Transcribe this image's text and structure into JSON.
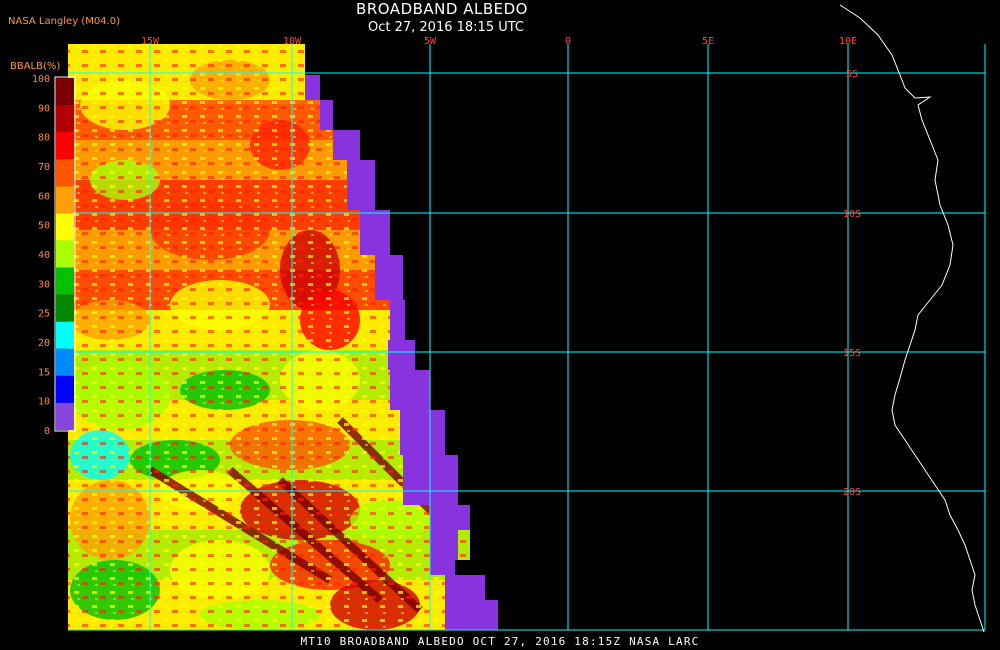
{
  "header": {
    "title": "BROADBAND ALBEDO",
    "datetime": "Oct 27, 2016 18:15 UTC",
    "source": "NASA Langley (M04.0)"
  },
  "footer": {
    "text": "MT10   BROADBAND ALBEDO   OCT 27, 2016 18:15Z   NASA LARC"
  },
  "legend": {
    "label": "BBALB(%)",
    "ticks": [
      "100",
      "90",
      "80",
      "70",
      "60",
      "50",
      "40",
      "30",
      "25",
      "20",
      "15",
      "10",
      "0"
    ],
    "colors": [
      "#7a0000",
      "#b00000",
      "#ff0000",
      "#ff5500",
      "#ffa000",
      "#ffff00",
      "#a8ff00",
      "#00c000",
      "#008800",
      "#00ffff",
      "#0088ff",
      "#0000ff",
      "#8844dd"
    ]
  },
  "map": {
    "longitude_labels": [
      "15W",
      "10W",
      "5W",
      "0",
      "5E",
      "10E"
    ],
    "latitude_labels": [
      "5S",
      "10S",
      "15S",
      "20S"
    ],
    "grid_color": "#00ffff",
    "label_color_lon": "#ff4444",
    "label_color_lat": "#ff4444",
    "coast_color": "#ffffff",
    "no_data_color": "#8833dd",
    "background": "#000000"
  }
}
